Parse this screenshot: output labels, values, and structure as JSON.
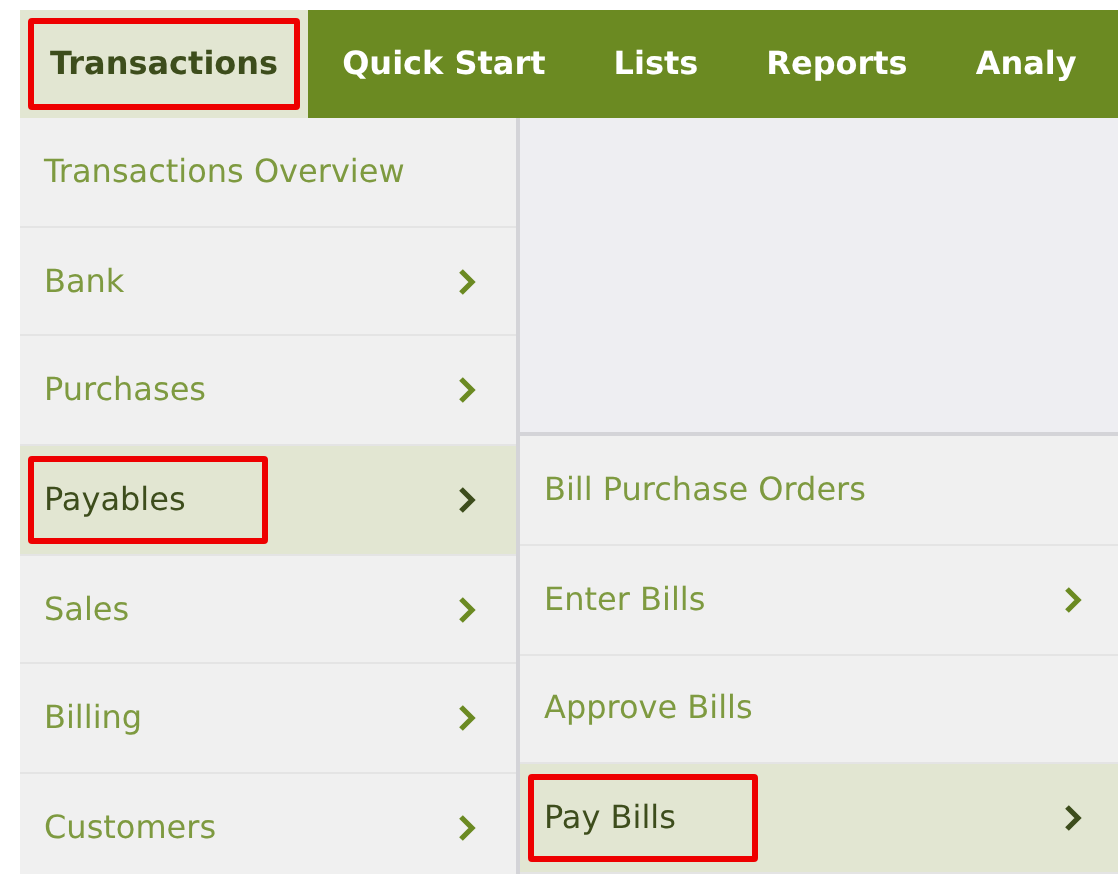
{
  "nav": [
    {
      "label": "Transactions",
      "selected": true,
      "highlighted": true
    },
    {
      "label": "Quick Start",
      "selected": false,
      "highlighted": false
    },
    {
      "label": "Lists",
      "selected": false,
      "highlighted": false
    },
    {
      "label": "Reports",
      "selected": false,
      "highlighted": false
    },
    {
      "label": "Analy",
      "selected": false,
      "highlighted": false
    }
  ],
  "menu": [
    {
      "label": "Transactions Overview",
      "has_submenu": false,
      "selected": false,
      "highlighted": false
    },
    {
      "label": "Bank",
      "has_submenu": true,
      "selected": false,
      "highlighted": false
    },
    {
      "label": "Purchases",
      "has_submenu": true,
      "selected": false,
      "highlighted": false
    },
    {
      "label": "Payables",
      "has_submenu": true,
      "selected": true,
      "highlighted": true
    },
    {
      "label": "Sales",
      "has_submenu": true,
      "selected": false,
      "highlighted": false
    },
    {
      "label": "Billing",
      "has_submenu": true,
      "selected": false,
      "highlighted": false
    },
    {
      "label": "Customers",
      "has_submenu": true,
      "selected": false,
      "highlighted": false
    }
  ],
  "submenu": [
    {
      "label": "Bill Purchase Orders",
      "has_submenu": false,
      "selected": false,
      "highlighted": false
    },
    {
      "label": "Enter Bills",
      "has_submenu": true,
      "selected": false,
      "highlighted": false
    },
    {
      "label": "Approve Bills",
      "has_submenu": false,
      "selected": false,
      "highlighted": false
    },
    {
      "label": "Pay Bills",
      "has_submenu": true,
      "selected": true,
      "highlighted": true
    }
  ]
}
